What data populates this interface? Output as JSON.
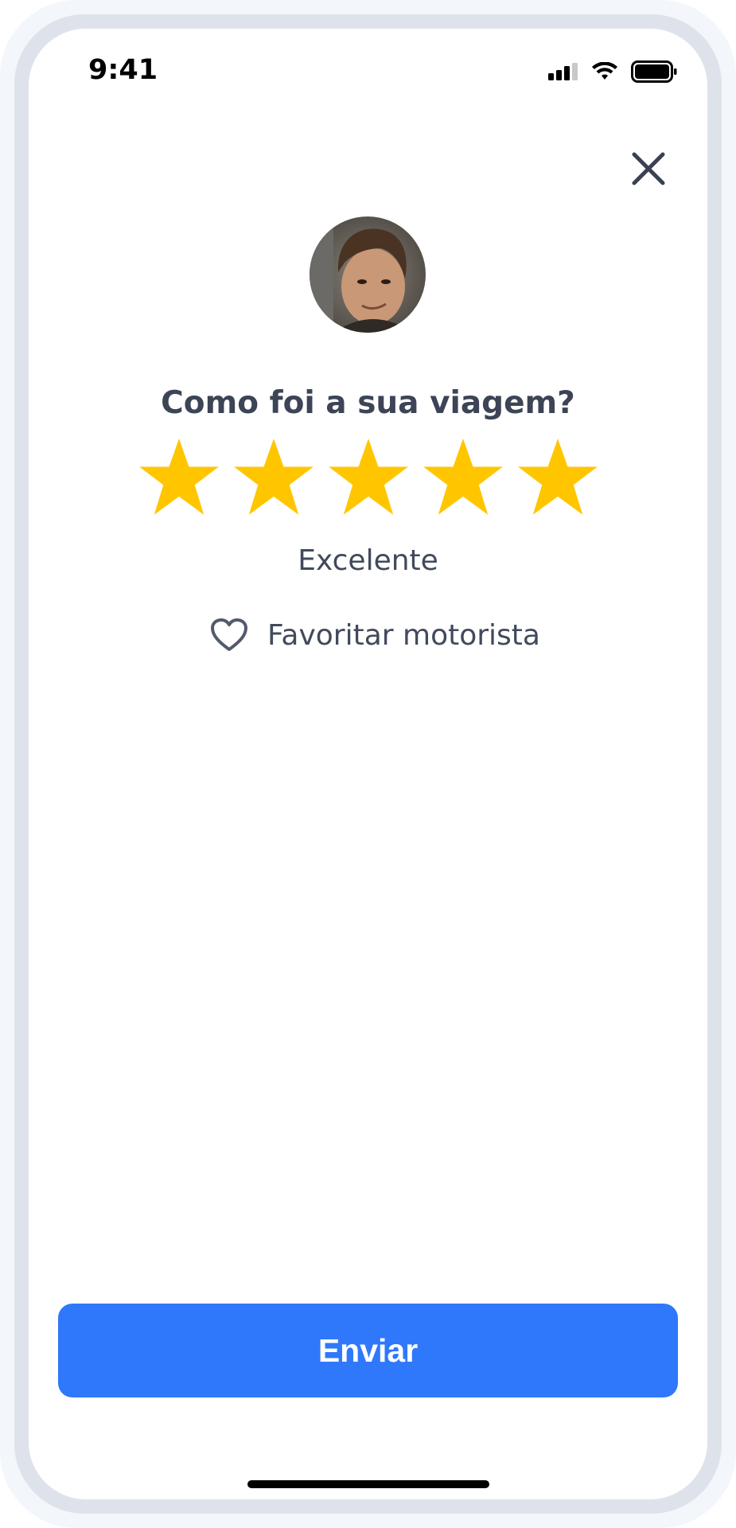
{
  "status_bar": {
    "time": "9:41",
    "icons": [
      "signal-icon",
      "wifi-icon",
      "battery-icon"
    ]
  },
  "header": {
    "close_icon": "close-icon"
  },
  "driver": {
    "avatar": "driver-avatar"
  },
  "rating": {
    "question": "Como foi a sua viagem?",
    "stars_total": 5,
    "stars_selected": 5,
    "label": "Excelente",
    "star_color": "#ffc600"
  },
  "favorite": {
    "icon": "heart-icon",
    "label": "Favoritar motorista"
  },
  "submit": {
    "label": "Enviar",
    "color": "#2f78fb"
  }
}
